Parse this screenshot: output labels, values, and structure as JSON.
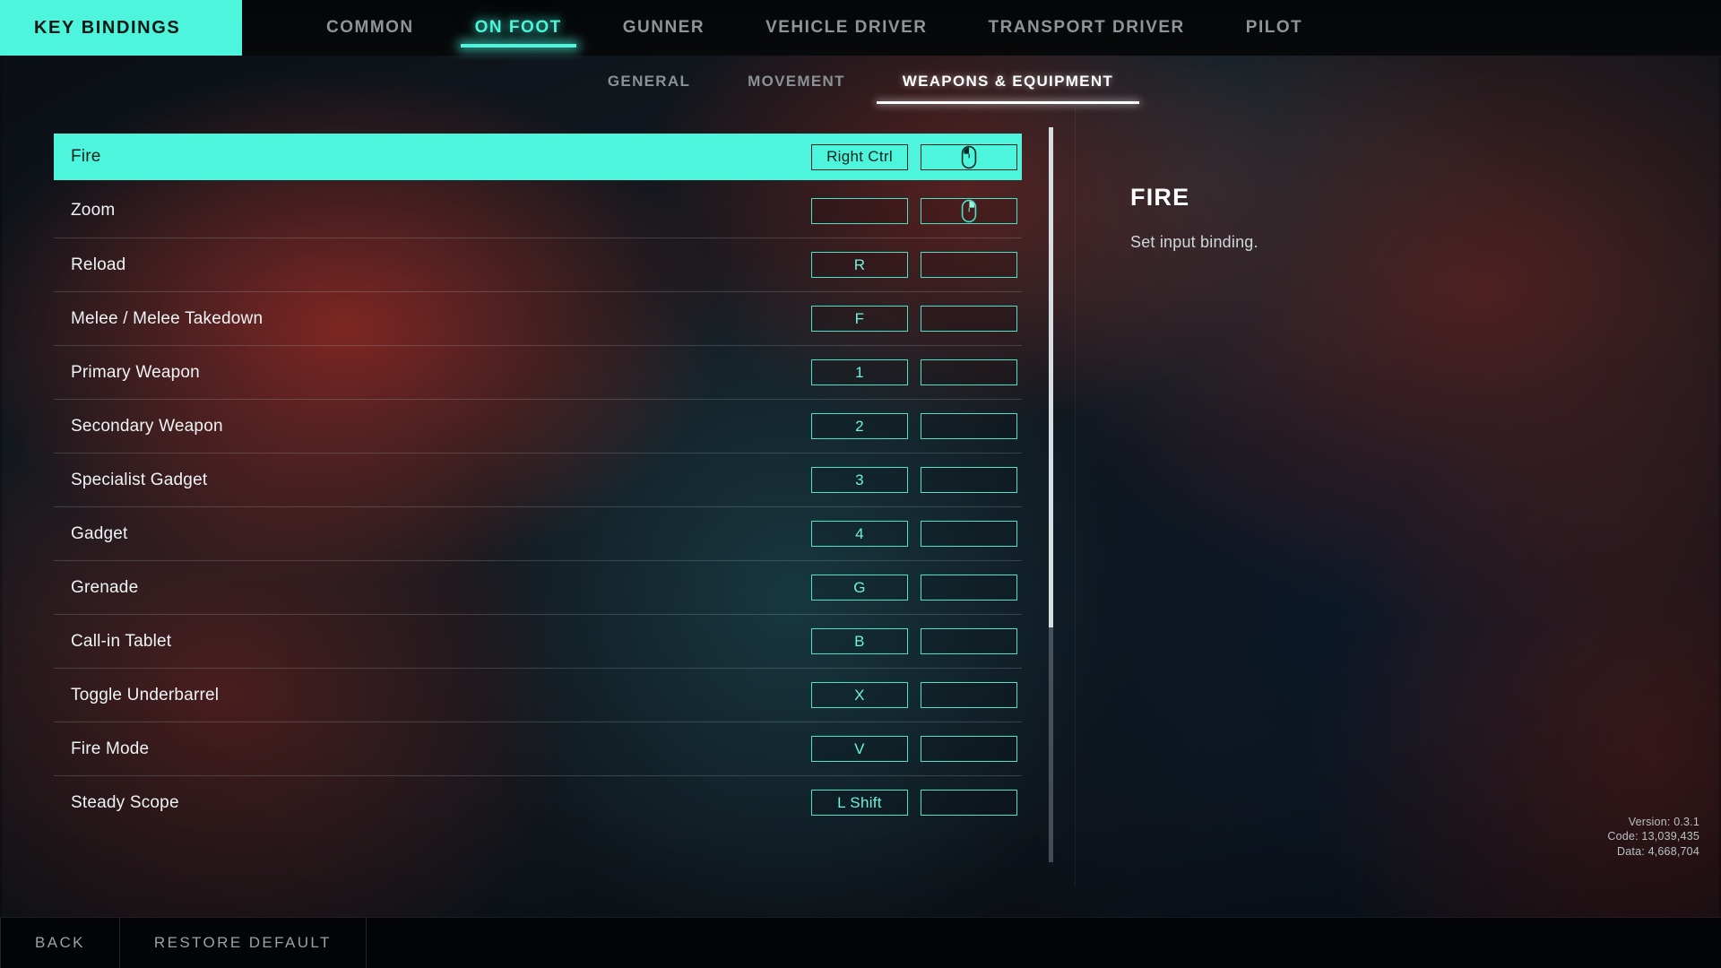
{
  "header": {
    "title": "KEY BINDINGS",
    "main_tabs": [
      {
        "label": "COMMON",
        "active": false
      },
      {
        "label": "ON FOOT",
        "active": true
      },
      {
        "label": "GUNNER",
        "active": false
      },
      {
        "label": "VEHICLE DRIVER",
        "active": false
      },
      {
        "label": "TRANSPORT DRIVER",
        "active": false
      },
      {
        "label": "PILOT",
        "active": false
      }
    ],
    "sub_tabs": [
      {
        "label": "GENERAL",
        "active": false
      },
      {
        "label": "MOVEMENT",
        "active": false
      },
      {
        "label": "WEAPONS & EQUIPMENT",
        "active": true
      }
    ]
  },
  "bindings": {
    "rows": [
      {
        "label": "Fire",
        "primary": "Right Ctrl",
        "secondary": "",
        "secondary_icon": "mouse-left-button-icon",
        "selected": true
      },
      {
        "label": "Zoom",
        "primary": "",
        "secondary": "",
        "secondary_icon": "mouse-right-button-icon",
        "selected": false
      },
      {
        "label": "Reload",
        "primary": "R",
        "secondary": "",
        "secondary_icon": "",
        "selected": false
      },
      {
        "label": "Melee / Melee Takedown",
        "primary": "F",
        "secondary": "",
        "secondary_icon": "",
        "selected": false
      },
      {
        "label": "Primary Weapon",
        "primary": "1",
        "secondary": "",
        "secondary_icon": "",
        "selected": false
      },
      {
        "label": "Secondary Weapon",
        "primary": "2",
        "secondary": "",
        "secondary_icon": "",
        "selected": false
      },
      {
        "label": "Specialist Gadget",
        "primary": "3",
        "secondary": "",
        "secondary_icon": "",
        "selected": false
      },
      {
        "label": "Gadget",
        "primary": "4",
        "secondary": "",
        "secondary_icon": "",
        "selected": false
      },
      {
        "label": "Grenade",
        "primary": "G",
        "secondary": "",
        "secondary_icon": "",
        "selected": false
      },
      {
        "label": "Call-in Tablet",
        "primary": "B",
        "secondary": "",
        "secondary_icon": "",
        "selected": false
      },
      {
        "label": "Toggle Underbarrel",
        "primary": "X",
        "secondary": "",
        "secondary_icon": "",
        "selected": false
      },
      {
        "label": "Fire Mode",
        "primary": "V",
        "secondary": "",
        "secondary_icon": "",
        "selected": false
      },
      {
        "label": "Steady Scope",
        "primary": "L Shift",
        "secondary": "",
        "secondary_icon": "",
        "selected": false
      }
    ],
    "scrollbar": {
      "thumb_percent": 68
    }
  },
  "detail": {
    "title": "FIRE",
    "description": "Set input binding."
  },
  "build_info": {
    "version": "Version: 0.3.1",
    "code": "Code: 13,039,435",
    "data": "Data: 4,668,704"
  },
  "footer": {
    "buttons": [
      {
        "label": "BACK"
      },
      {
        "label": "RESTORE DEFAULT"
      }
    ]
  },
  "colors": {
    "accent": "#4df5dd",
    "accent_border": "#4ae3c8",
    "accent_text": "#6ff3de",
    "text_primary": "#eef4f6",
    "text_muted": "#8e9598",
    "bar_dark": "#030405"
  }
}
